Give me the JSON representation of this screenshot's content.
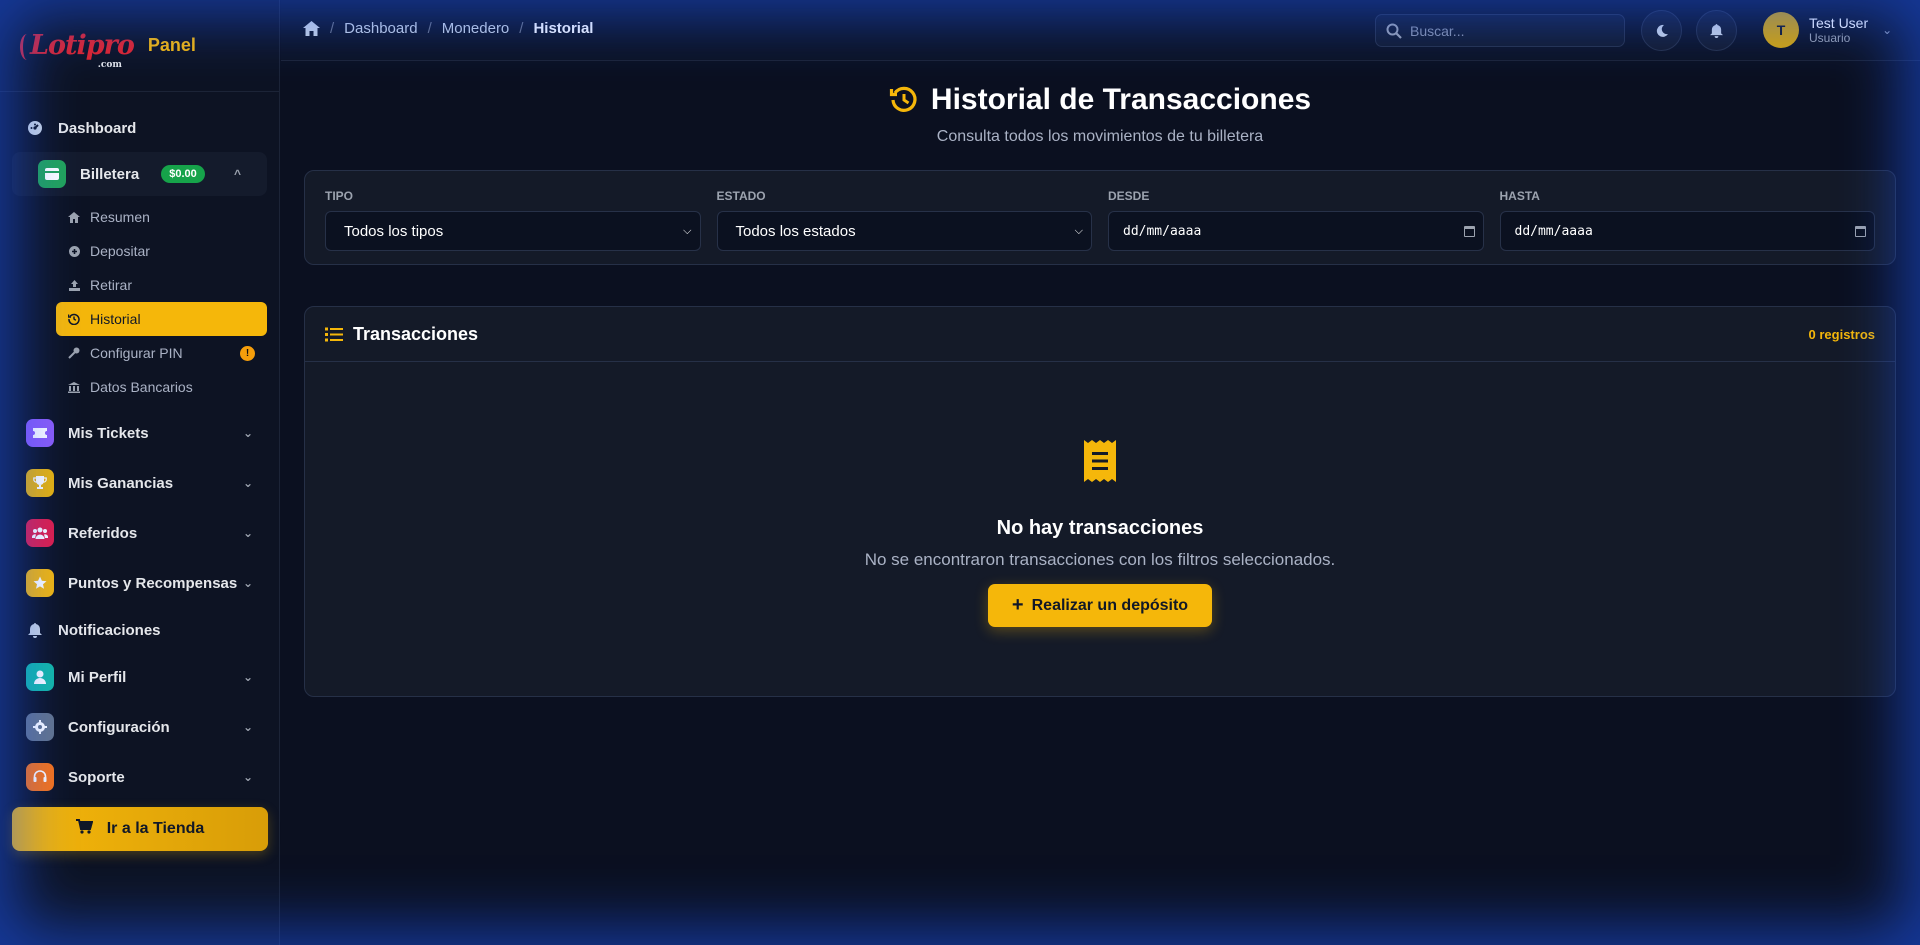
{
  "brand": {
    "logo_text": "Lotipro",
    "logo_suffix": ".com",
    "panel_label": "Panel"
  },
  "sidebar": {
    "dashboard": "Dashboard",
    "wallet": {
      "label": "Billetera",
      "balance": "$0.00"
    },
    "wallet_items": [
      {
        "label": "Resumen",
        "icon": "home-icon"
      },
      {
        "label": "Depositar",
        "icon": "plus-circle-icon"
      },
      {
        "label": "Retirar",
        "icon": "upload-icon"
      },
      {
        "label": "Historial",
        "icon": "history-icon",
        "active": true
      },
      {
        "label": "Configurar PIN",
        "icon": "key-icon",
        "badge": "!"
      },
      {
        "label": "Datos Bancarios",
        "icon": "bank-icon"
      }
    ],
    "groups": [
      {
        "label": "Mis Tickets",
        "icon": "ticket-icon",
        "color": "#8b5cf6"
      },
      {
        "label": "Mis Ganancias",
        "icon": "trophy-icon",
        "color": "#eab308"
      },
      {
        "label": "Referidos",
        "icon": "users-icon",
        "color": "#e11d48"
      },
      {
        "label": "Puntos y Recompensas",
        "icon": "star-icon",
        "color": "#f5b70a"
      },
      {
        "label": "Notificaciones",
        "icon": "bell-icon"
      },
      {
        "label": "Mi Perfil",
        "icon": "user-icon",
        "color": "#14b8a6"
      },
      {
        "label": "Configuración",
        "icon": "gear-icon",
        "color": "#64748b"
      },
      {
        "label": "Soporte",
        "icon": "headset-icon",
        "color": "#f97316"
      }
    ],
    "store_button": "Ir a la Tienda"
  },
  "topbar": {
    "breadcrumb": [
      "Dashboard",
      "Monedero",
      "Historial"
    ],
    "search_placeholder": "Buscar...",
    "user_name": "Test User",
    "user_role": "Usuario",
    "avatar_initial": "T"
  },
  "page": {
    "title": "Historial de Transacciones",
    "subtitle": "Consulta todos los movimientos de tu billetera"
  },
  "filters": {
    "type_label": "TIPO",
    "type_value": "Todos los tipos",
    "status_label": "ESTADO",
    "status_value": "Todos los estados",
    "from_label": "DESDE",
    "from_value": "dd/mm/aaaa",
    "to_label": "HASTA",
    "to_value": "dd/mm/aaaa"
  },
  "transactions": {
    "title": "Transacciones",
    "count": "0 registros",
    "empty_title": "No hay transacciones",
    "empty_subtitle": "No se encontraron transacciones con los filtros seleccionados.",
    "deposit_button": "Realizar un depósito"
  },
  "colors": {
    "accent": "#f5b70a",
    "success": "#16a34a",
    "background": "#0b1020"
  }
}
